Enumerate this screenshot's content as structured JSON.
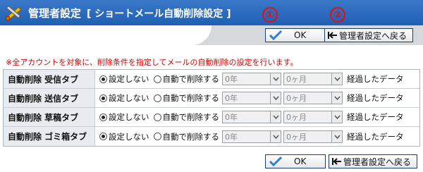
{
  "header": {
    "title": "管理者設定",
    "subtitle": "[ ショートメール自動削除設定 ]"
  },
  "toolbar": {
    "ok_label": "OK",
    "back_label": "管理者設定へ戻る",
    "marker_1": "①",
    "marker_2": "②"
  },
  "notice": "※全アカウントを対象に、削除条件を指定してメールの自動削除の設定を行います。",
  "rows": [
    {
      "label": "自動削除 受信タブ",
      "option_none": "設定しない",
      "option_auto": "自動で削除する",
      "selected": "none",
      "years": "0年",
      "months": "0ヶ月",
      "elapsed": "経過したデータ"
    },
    {
      "label": "自動削除 送信タブ",
      "option_none": "設定しない",
      "option_auto": "自動で削除する",
      "selected": "none",
      "years": "0年",
      "months": "0ヶ月",
      "elapsed": "経過したデータ"
    },
    {
      "label": "自動削除 草稿タブ",
      "option_none": "設定しない",
      "option_auto": "自動で削除する",
      "selected": "none",
      "years": "0年",
      "months": "0ヶ月",
      "elapsed": "経過したデータ"
    },
    {
      "label": "自動削除 ゴミ箱タブ",
      "option_none": "設定しない",
      "option_auto": "自動で削除する",
      "selected": "none",
      "years": "0年",
      "months": "0ヶ月",
      "elapsed": "経過したデータ"
    }
  ],
  "footer": {
    "ok_label": "OK",
    "back_label": "管理者設定へ戻る"
  },
  "icons": {
    "header": "tools-icon",
    "ok": "check-icon",
    "back": "back-arrow-icon",
    "dropdown": "chevron-down-icon"
  },
  "colors": {
    "header_bg": "#2a6bbf",
    "band_bg": "#d6d9dc",
    "notice_text": "#d00000",
    "label_bg": "#e8ecf1",
    "marker": "#e01010"
  }
}
